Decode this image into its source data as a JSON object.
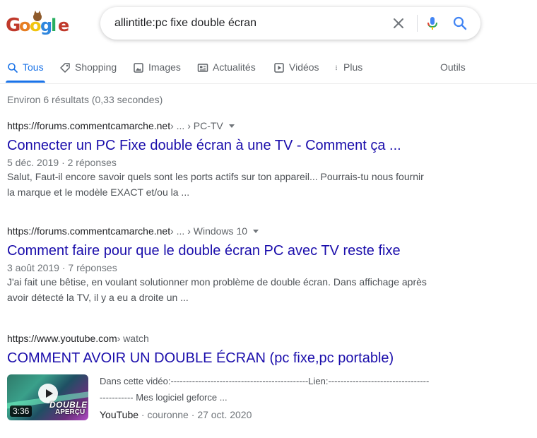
{
  "logo": {
    "letters": [
      "G",
      "o",
      "o",
      "g",
      "l",
      "e"
    ]
  },
  "search": {
    "query": "allintitle:pc fixe double écran",
    "clear_icon": "close-icon",
    "voice_icon": "mic-icon",
    "submit_icon": "search-icon"
  },
  "tabs": [
    {
      "label": "Tous",
      "icon": "search-icon",
      "active": true
    },
    {
      "label": "Shopping",
      "icon": "tag-icon"
    },
    {
      "label": "Images",
      "icon": "image-icon"
    },
    {
      "label": "Actualités",
      "icon": "news-icon"
    },
    {
      "label": "Vidéos",
      "icon": "play-icon"
    },
    {
      "label": "Plus",
      "icon": "more-vert-icon"
    }
  ],
  "tools_label": "Outils",
  "stats": "Environ 6 résultats (0,33 secondes)",
  "results": [
    {
      "site": "https://forums.commentcamarche.net",
      "path": " › ... › PC-TV",
      "title": "Connecter un PC Fixe double écran à une TV - Comment ça ...",
      "date": "5 déc. 2019",
      "replies": "2 réponses",
      "snippet": "Salut, Faut-il encore savoir quels sont les ports actifs sur ton appareil... Pourrais-tu nous fournir la marque et le modèle EXACT et/ou la ..."
    },
    {
      "site": "https://forums.commentcamarche.net",
      "path": " › ... › Windows 10",
      "title": "Comment faire pour que le double écran PC avec TV reste fixe",
      "date": "3 août 2019",
      "replies": "7 réponses",
      "snippet": "J'ai fait une bêtise, en voulant solutionner mon problème de double écran. Dans affichage après avoir détecté la TV, il y a eu a droite un ..."
    }
  ],
  "video_result": {
    "site": "https://www.youtube.com",
    "path": " › watch",
    "title": "COMMENT AVOIR UN DOUBLE ÉCRAN (pc fixe,pc portable)",
    "duration": "3:36",
    "thumb_text": "DOUBLE",
    "thumb_text2": "APERÇU",
    "snippet": "Dans cette vidéo:---------------------------------------------Lien:-------------------------------------------- Mes logiciel geforce ...",
    "source": "YouTube",
    "channel": "couronne",
    "date": "27 oct. 2020"
  }
}
